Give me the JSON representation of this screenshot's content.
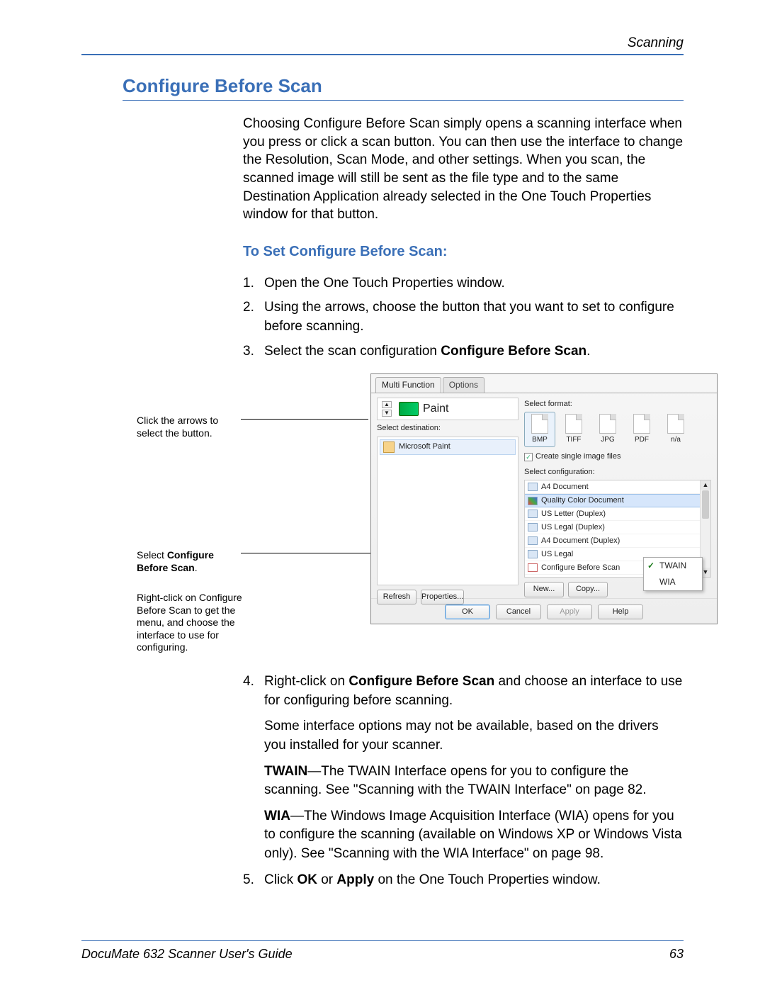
{
  "header": {
    "section": "Scanning"
  },
  "h1": "Configure Before Scan",
  "intro": "Choosing Configure Before Scan simply opens a scanning interface when you press or click a scan button. You can then use the interface to change the Resolution, Scan Mode, and other settings. When you scan, the scanned image will still be sent as the file type and to the same Destination Application already selected in the One Touch Properties window for that button.",
  "h2": "To Set Configure Before Scan:",
  "steps": {
    "s1": "Open the One Touch Properties window.",
    "s2": "Using the arrows, choose the button that you want to set to configure before scanning.",
    "s3_pre": "Select the scan configuration ",
    "s3_bold": "Configure Before Scan",
    "s3_post": ".",
    "s4_pre": "Right-click on ",
    "s4_bold": "Configure Before Scan",
    "s4_post": " and choose an interface to use for configuring before scanning.",
    "s4_sub1": "Some interface options may not be available, based on the drivers you installed for your scanner.",
    "s4_twain_bold": "TWAIN",
    "s4_twain_rest": "—The TWAIN Interface opens for you to configure the scanning. See \"Scanning with the TWAIN Interface\" on page 82.",
    "s4_wia_bold": "WIA",
    "s4_wia_rest": "—The Windows Image Acquisition Interface (WIA) opens for you to configure the scanning (available on Windows XP or Windows Vista only). See \"Scanning with the WIA Interface\" on page 98.",
    "s5_pre": "Click ",
    "s5_b1": "OK",
    "s5_mid": " or ",
    "s5_b2": "Apply",
    "s5_post": " on the One Touch Properties window."
  },
  "callouts": {
    "c1": "Click the arrows to select the button.",
    "c2a": "Select ",
    "c2b": "Configure Before Scan",
    "c2c": ".",
    "c3": "Right-click on Configure Before Scan to get the menu, and choose the interface to use for configuring."
  },
  "dialog": {
    "tabs": [
      "Multi Function",
      "Options"
    ],
    "paint": "Paint",
    "sel_dest_label": "Select destination:",
    "dest_item": "Microsoft Paint",
    "sel_fmt_label": "Select format:",
    "formats": [
      "BMP",
      "TIFF",
      "JPG",
      "PDF",
      "n/a"
    ],
    "chk_label": "Create single image files",
    "sel_cfg_label": "Select configuration:",
    "cfgs": [
      "A4 Document",
      "Quality Color Document",
      "US Letter (Duplex)",
      "US Legal (Duplex)",
      "A4 Document (Duplex)",
      "US Legal",
      "Configure Before Scan"
    ],
    "left_buttons": [
      "Refresh",
      "Properties..."
    ],
    "right_buttons": [
      "New...",
      "Copy..."
    ],
    "ctx": [
      "TWAIN",
      "WIA"
    ],
    "bottom": [
      "OK",
      "Cancel",
      "Apply",
      "Help"
    ]
  },
  "footer": {
    "left": "DocuMate 632 Scanner User's Guide",
    "right": "63"
  }
}
